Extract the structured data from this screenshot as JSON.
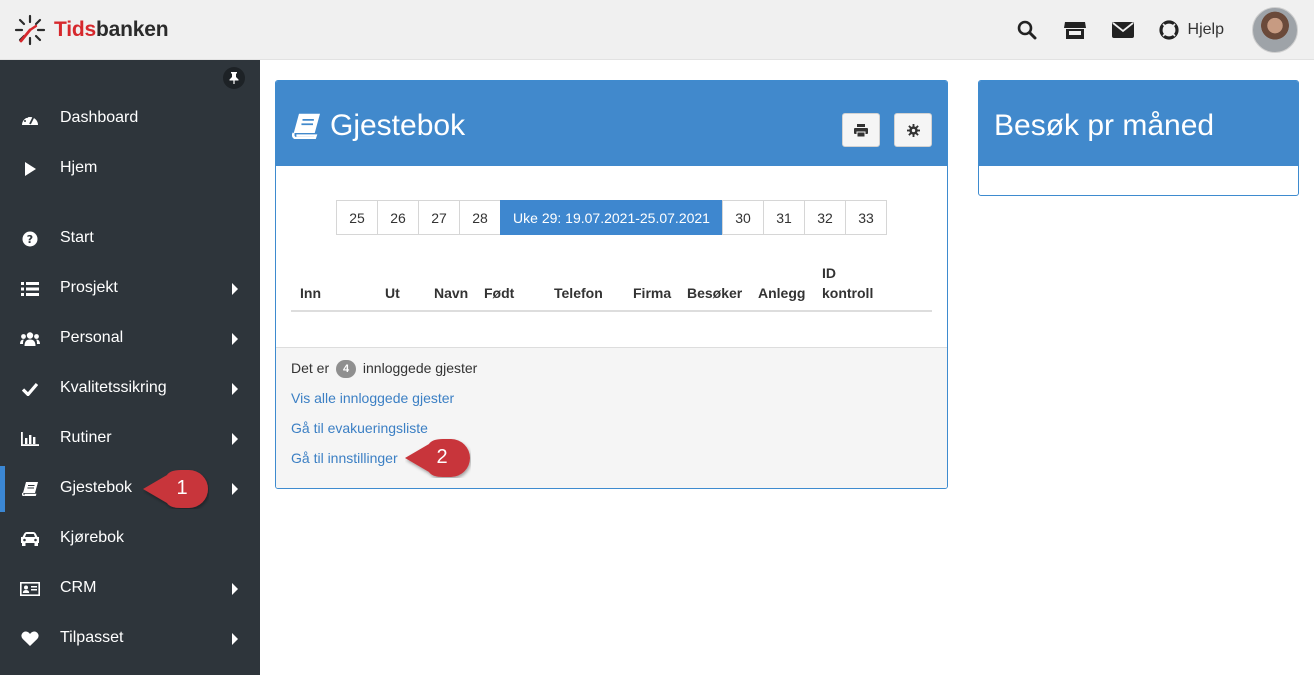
{
  "brand": {
    "part1": "Tids",
    "part2": "banken",
    "accent": "#d6282d"
  },
  "topbar": {
    "icons": [
      "search-icon",
      "store-icon",
      "envelope-icon",
      "lifebuoy-icon"
    ],
    "help_label": "Hjelp"
  },
  "sidebar": {
    "items": [
      {
        "label": "Dashboard",
        "icon": "dashboard-icon",
        "has_submenu": false
      },
      {
        "label": "Hjem",
        "icon": "play-icon",
        "has_submenu": false
      },
      {
        "label": "Start",
        "icon": "question-circle-icon",
        "has_submenu": false
      },
      {
        "label": "Prosjekt",
        "icon": "list-icon",
        "has_submenu": true
      },
      {
        "label": "Personal",
        "icon": "users-icon",
        "has_submenu": true
      },
      {
        "label": "Kvalitetssikring",
        "icon": "check-icon",
        "has_submenu": true
      },
      {
        "label": "Rutiner",
        "icon": "bar-chart-icon",
        "has_submenu": true
      },
      {
        "label": "Gjestebok",
        "icon": "book-icon",
        "has_submenu": true,
        "active": true
      },
      {
        "label": "Kjørebok",
        "icon": "car-icon",
        "has_submenu": false
      },
      {
        "label": "CRM",
        "icon": "id-card-icon",
        "has_submenu": true
      },
      {
        "label": "Tilpasset",
        "icon": "heart-icon",
        "has_submenu": true
      }
    ]
  },
  "callouts": {
    "first": "1",
    "second": "2",
    "color": "#c8343a"
  },
  "gjestebok": {
    "title": "Gjestebok",
    "weeks": [
      "25",
      "26",
      "27",
      "28",
      "Uke 29: 19.07.2021-25.07.2021",
      "30",
      "31",
      "32",
      "33"
    ],
    "active_week": "Uke 29: 19.07.2021-25.07.2021",
    "columns": [
      "Inn",
      "Ut",
      "Navn",
      "Født",
      "Telefon",
      "Firma",
      "Besøker",
      "Anlegg",
      "ID",
      "kontroll"
    ],
    "footer": {
      "prefix": "Det er",
      "count": "4",
      "suffix": "innloggede gjester",
      "links": [
        "Vis alle innloggede gjester",
        "Gå til evakueringsliste",
        "Gå til innstillinger"
      ]
    }
  },
  "besok": {
    "title": "Besøk pr måned"
  }
}
